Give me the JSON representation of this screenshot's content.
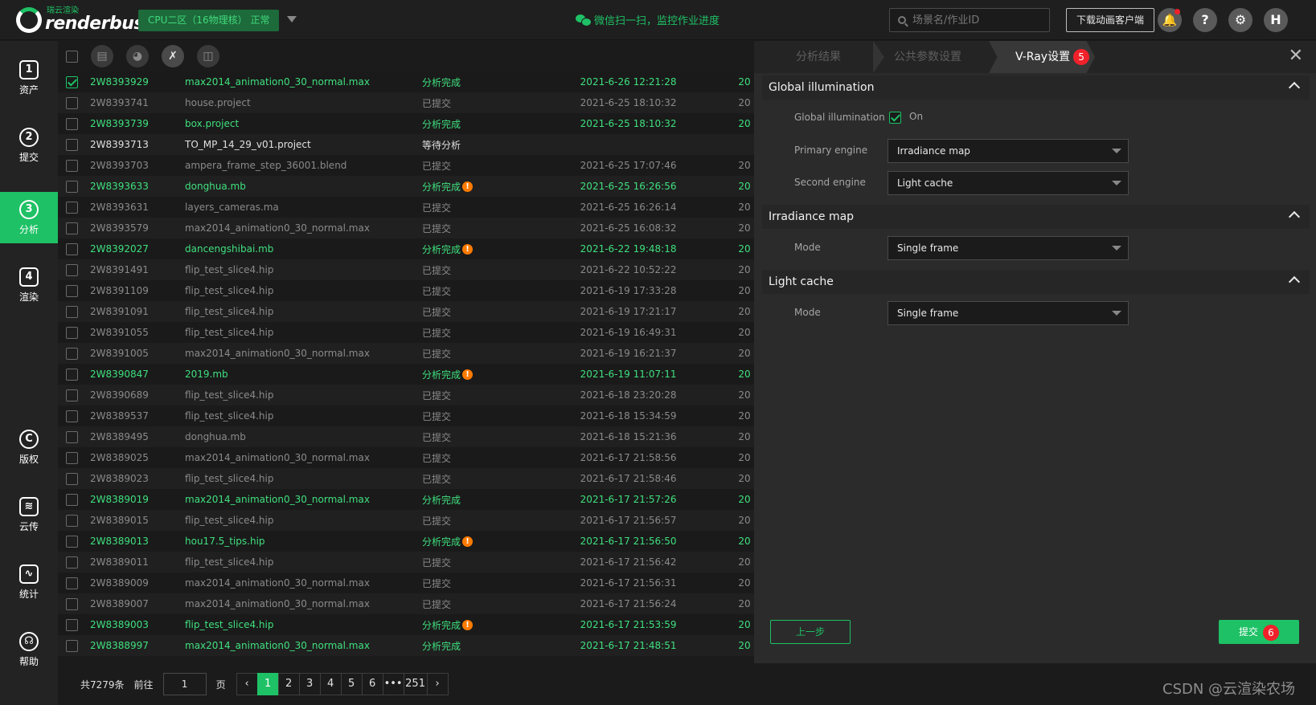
{
  "header": {
    "logo_cn": "瑞云渲染",
    "logo_en": "renderbus",
    "zone": "CPU二区（16物理核）  正常",
    "wechat": "微信扫一扫，监控作业进度",
    "search_placeholder": "场景名/作业ID",
    "download_btn": "下载动画客户端",
    "help_glyph": "?",
    "settings_glyph": "⚙",
    "avatar_letter": "H"
  },
  "nav": [
    {
      "label": "资产",
      "glyph": "1"
    },
    {
      "label": "提交",
      "glyph": "2"
    },
    {
      "label": "分析",
      "glyph": "3"
    },
    {
      "label": "渲染",
      "glyph": "4"
    },
    {
      "label": "版权",
      "glyph": "C"
    },
    {
      "label": "云传",
      "glyph": "≋"
    },
    {
      "label": "统计",
      "glyph": "∿"
    },
    {
      "label": "帮助",
      "glyph": "☊"
    }
  ],
  "rows": [
    {
      "id": "2W8393929",
      "name": "max2014_animation0_30_normal.max",
      "status": "分析完成",
      "time": "2021-6-26 12:21:28",
      "extra": "20",
      "state": "done",
      "checked": true,
      "warn": false
    },
    {
      "id": "2W8393741",
      "name": "house.project",
      "status": "已提交",
      "time": "2021-6-25 18:10:32",
      "extra": "20",
      "state": "muted",
      "checked": false,
      "warn": false
    },
    {
      "id": "2W8393739",
      "name": "box.project",
      "status": "分析完成",
      "time": "2021-6-25 18:10:32",
      "extra": "20",
      "state": "done",
      "checked": false,
      "warn": false
    },
    {
      "id": "2W8393713",
      "name": "TO_MP_14_29_v01.project",
      "status": "等待分析",
      "time": "",
      "extra": "",
      "state": "pending",
      "checked": false,
      "warn": false
    },
    {
      "id": "2W8393703",
      "name": "ampera_frame_step_36001.blend",
      "status": "已提交",
      "time": "2021-6-25 17:07:46",
      "extra": "20",
      "state": "muted",
      "checked": false,
      "warn": false
    },
    {
      "id": "2W8393633",
      "name": "donghua.mb",
      "status": "分析完成",
      "time": "2021-6-25 16:26:56",
      "extra": "20",
      "state": "done",
      "checked": false,
      "warn": true
    },
    {
      "id": "2W8393631",
      "name": "layers_cameras.ma",
      "status": "已提交",
      "time": "2021-6-25 16:26:14",
      "extra": "20",
      "state": "muted",
      "checked": false,
      "warn": false
    },
    {
      "id": "2W8393579",
      "name": "max2014_animation0_30_normal.max",
      "status": "已提交",
      "time": "2021-6-25 16:08:32",
      "extra": "20",
      "state": "muted",
      "checked": false,
      "warn": false
    },
    {
      "id": "2W8392027",
      "name": "dancengshibai.mb",
      "status": "分析完成",
      "time": "2021-6-22 19:48:18",
      "extra": "20",
      "state": "done",
      "checked": false,
      "warn": true
    },
    {
      "id": "2W8391491",
      "name": "flip_test_slice4.hip",
      "status": "已提交",
      "time": "2021-6-22 10:52:22",
      "extra": "20",
      "state": "muted",
      "checked": false,
      "warn": false
    },
    {
      "id": "2W8391109",
      "name": "flip_test_slice4.hip",
      "status": "已提交",
      "time": "2021-6-19 17:33:28",
      "extra": "20",
      "state": "muted",
      "checked": false,
      "warn": false
    },
    {
      "id": "2W8391091",
      "name": "flip_test_slice4.hip",
      "status": "已提交",
      "time": "2021-6-19 17:21:17",
      "extra": "20",
      "state": "muted",
      "checked": false,
      "warn": false
    },
    {
      "id": "2W8391055",
      "name": "flip_test_slice4.hip",
      "status": "已提交",
      "time": "2021-6-19 16:49:31",
      "extra": "20",
      "state": "muted",
      "checked": false,
      "warn": false
    },
    {
      "id": "2W8391005",
      "name": "max2014_animation0_30_normal.max",
      "status": "已提交",
      "time": "2021-6-19 16:21:37",
      "extra": "20",
      "state": "muted",
      "checked": false,
      "warn": false
    },
    {
      "id": "2W8390847",
      "name": "2019.mb",
      "status": "分析完成",
      "time": "2021-6-19 11:07:11",
      "extra": "20",
      "state": "done",
      "checked": false,
      "warn": true
    },
    {
      "id": "2W8390689",
      "name": "flip_test_slice4.hip",
      "status": "已提交",
      "time": "2021-6-18 23:20:28",
      "extra": "20",
      "state": "muted",
      "checked": false,
      "warn": false
    },
    {
      "id": "2W8389537",
      "name": "flip_test_slice4.hip",
      "status": "已提交",
      "time": "2021-6-18 15:34:59",
      "extra": "20",
      "state": "muted",
      "checked": false,
      "warn": false
    },
    {
      "id": "2W8389495",
      "name": "donghua.mb",
      "status": "已提交",
      "time": "2021-6-18 15:21:36",
      "extra": "20",
      "state": "muted",
      "checked": false,
      "warn": false
    },
    {
      "id": "2W8389025",
      "name": "max2014_animation0_30_normal.max",
      "status": "已提交",
      "time": "2021-6-17 21:58:56",
      "extra": "20",
      "state": "muted",
      "checked": false,
      "warn": false
    },
    {
      "id": "2W8389023",
      "name": "flip_test_slice4.hip",
      "status": "已提交",
      "time": "2021-6-17 21:58:46",
      "extra": "20",
      "state": "muted",
      "checked": false,
      "warn": false
    },
    {
      "id": "2W8389019",
      "name": "max2014_animation0_30_normal.max",
      "status": "分析完成",
      "time": "2021-6-17 21:57:26",
      "extra": "20",
      "state": "done",
      "checked": false,
      "warn": false
    },
    {
      "id": "2W8389015",
      "name": "flip_test_slice4.hip",
      "status": "已提交",
      "time": "2021-6-17 21:56:57",
      "extra": "20",
      "state": "muted",
      "checked": false,
      "warn": false
    },
    {
      "id": "2W8389013",
      "name": "hou17.5_tips.hip",
      "status": "分析完成",
      "time": "2021-6-17 21:56:50",
      "extra": "20",
      "state": "done",
      "checked": false,
      "warn": true
    },
    {
      "id": "2W8389011",
      "name": "flip_test_slice4.hip",
      "status": "已提交",
      "time": "2021-6-17 21:56:42",
      "extra": "20",
      "state": "muted",
      "checked": false,
      "warn": false
    },
    {
      "id": "2W8389009",
      "name": "max2014_animation0_30_normal.max",
      "status": "已提交",
      "time": "2021-6-17 21:56:31",
      "extra": "20",
      "state": "muted",
      "checked": false,
      "warn": false
    },
    {
      "id": "2W8389007",
      "name": "max2014_animation0_30_normal.max",
      "status": "已提交",
      "time": "2021-6-17 21:56:24",
      "extra": "20",
      "state": "muted",
      "checked": false,
      "warn": false
    },
    {
      "id": "2W8389003",
      "name": "flip_test_slice4.hip",
      "status": "分析完成",
      "time": "2021-6-17 21:53:59",
      "extra": "20",
      "state": "done",
      "checked": false,
      "warn": true
    },
    {
      "id": "2W8388997",
      "name": "max2014_animation0_30_normal.max",
      "status": "分析完成",
      "time": "2021-6-17 21:48:51",
      "extra": "20",
      "state": "done",
      "checked": false,
      "warn": false
    }
  ],
  "warn_glyph": "!",
  "pager": {
    "total": "共7279条",
    "goto": "前往",
    "goto_value": "1",
    "page_unit": "页",
    "prev": "‹",
    "pages": [
      "1",
      "2",
      "3",
      "4",
      "5",
      "6"
    ],
    "ellipsis": "•••",
    "last": "251",
    "next": "›"
  },
  "panel": {
    "tabs": [
      "分析结果",
      "公共参数设置",
      "V-Ray设置"
    ],
    "tab_badge": "5",
    "close": "✕",
    "sections": {
      "gi": {
        "title": "Global illumination",
        "gi_label": "Global illumination",
        "gi_on": "On",
        "primary_label": "Primary engine",
        "primary_value": "Irradiance map",
        "second_label": "Second engine",
        "second_value": "Light cache"
      },
      "irr": {
        "title": "Irradiance map",
        "mode_label": "Mode",
        "mode_value": "Single frame"
      },
      "lc": {
        "title": "Light cache",
        "mode_label": "Mode",
        "mode_value": "Single frame"
      }
    },
    "prev_btn": "上一步",
    "submit_btn": "提交",
    "submit_badge": "6"
  },
  "watermark": "CSDN @云渲染农场"
}
